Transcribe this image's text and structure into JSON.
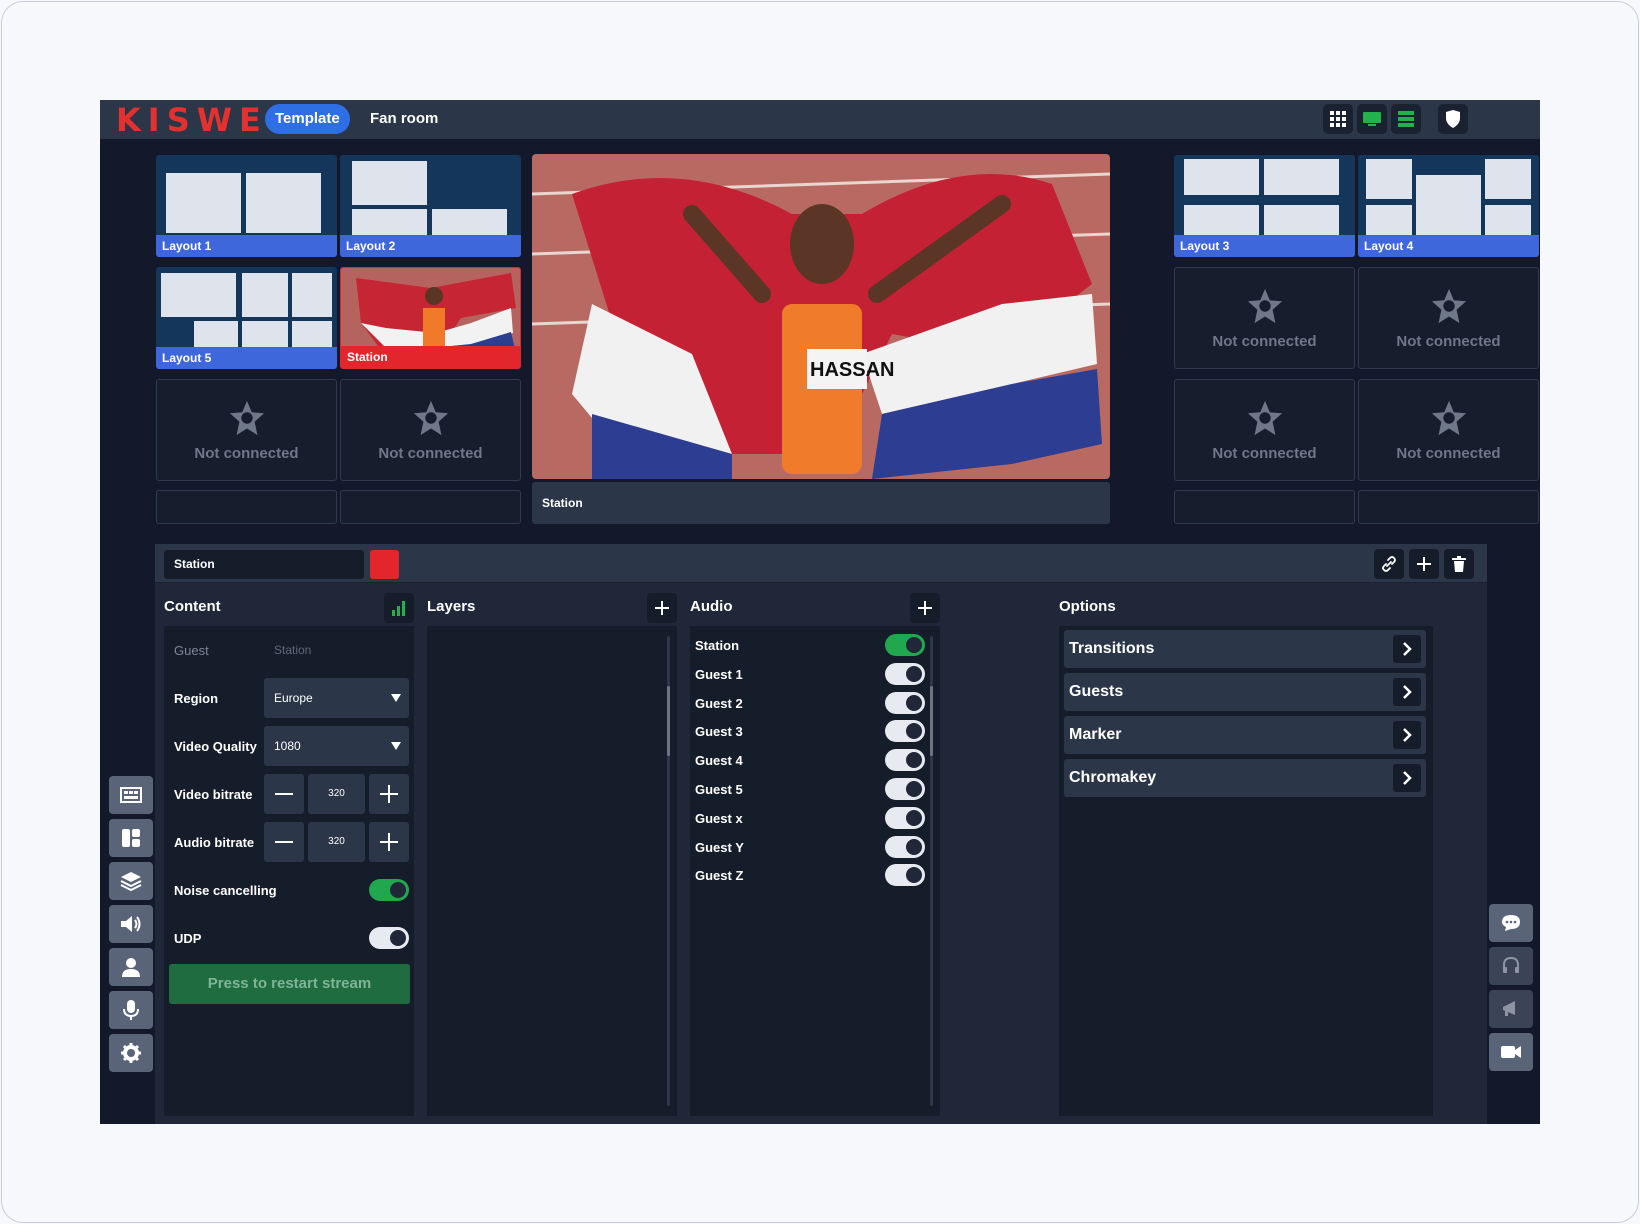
{
  "app": {
    "logo": "KISWE"
  },
  "topbar": {
    "tabs": [
      {
        "label": "Template",
        "active": true
      },
      {
        "label": "Fan room",
        "active": false
      }
    ],
    "icons": [
      "grid-view-icon",
      "monitor-icon",
      "list-view-icon",
      "shield-icon"
    ]
  },
  "sources": {
    "left": [
      {
        "label": "Layout 1",
        "kind": "layout"
      },
      {
        "label": "Layout 2",
        "kind": "layout"
      },
      {
        "label": "Layout 5",
        "kind": "layout"
      },
      {
        "label": "Station",
        "kind": "video"
      },
      {
        "label": "Not connected",
        "kind": "empty"
      },
      {
        "label": "Not connected",
        "kind": "empty"
      }
    ],
    "right": [
      {
        "label": "Layout 3",
        "kind": "layout"
      },
      {
        "label": "Layout 4",
        "kind": "layout"
      },
      {
        "label": "Not connected",
        "kind": "empty"
      },
      {
        "label": "Not connected",
        "kind": "empty"
      },
      {
        "label": "Not connected",
        "kind": "empty"
      },
      {
        "label": "Not connected",
        "kind": "empty"
      }
    ]
  },
  "preview": {
    "label": "Station",
    "bib_text": "HASSAN"
  },
  "editor": {
    "name": "Station",
    "color": "#e3262b",
    "content": {
      "title": "Content",
      "guest_label": "Guest",
      "guest_placeholder": "Station",
      "region_label": "Region",
      "region_value": "Europe",
      "quality_label": "Video Quality",
      "quality_value": "1080",
      "video_bitrate_label": "Video bitrate",
      "video_bitrate_value": "320",
      "audio_bitrate_label": "Audio bitrate",
      "audio_bitrate_value": "320",
      "noise_label": "Noise cancelling",
      "noise_on": true,
      "udp_label": "UDP",
      "udp_on": false,
      "restart_label": "Press to restart stream"
    },
    "layers": {
      "title": "Layers"
    },
    "audio": {
      "title": "Audio",
      "items": [
        {
          "label": "Station",
          "on": true
        },
        {
          "label": "Guest 1",
          "on": false
        },
        {
          "label": "Guest 2",
          "on": false
        },
        {
          "label": "Guest 3",
          "on": false
        },
        {
          "label": "Guest 4",
          "on": false
        },
        {
          "label": "Guest 5",
          "on": false
        },
        {
          "label": "Guest x",
          "on": false
        },
        {
          "label": "Guest Y",
          "on": false
        },
        {
          "label": "Guest Z",
          "on": false
        }
      ]
    },
    "options": {
      "title": "Options",
      "items": [
        "Transitions",
        "Guests",
        "Marker",
        "Chromakey"
      ]
    }
  },
  "left_sidebar": [
    "layout-icon",
    "layout-split-icon",
    "layers-icon",
    "speaker-icon",
    "person-icon",
    "microphone-icon",
    "gear-icon"
  ],
  "right_sidebar": [
    "chat-icon",
    "headset-icon",
    "megaphone-icon",
    "video-camera-icon"
  ],
  "colors": {
    "accent": "#2f6fe6",
    "brand": "#e3312f",
    "success": "#21a84f",
    "background": "#13192a"
  }
}
